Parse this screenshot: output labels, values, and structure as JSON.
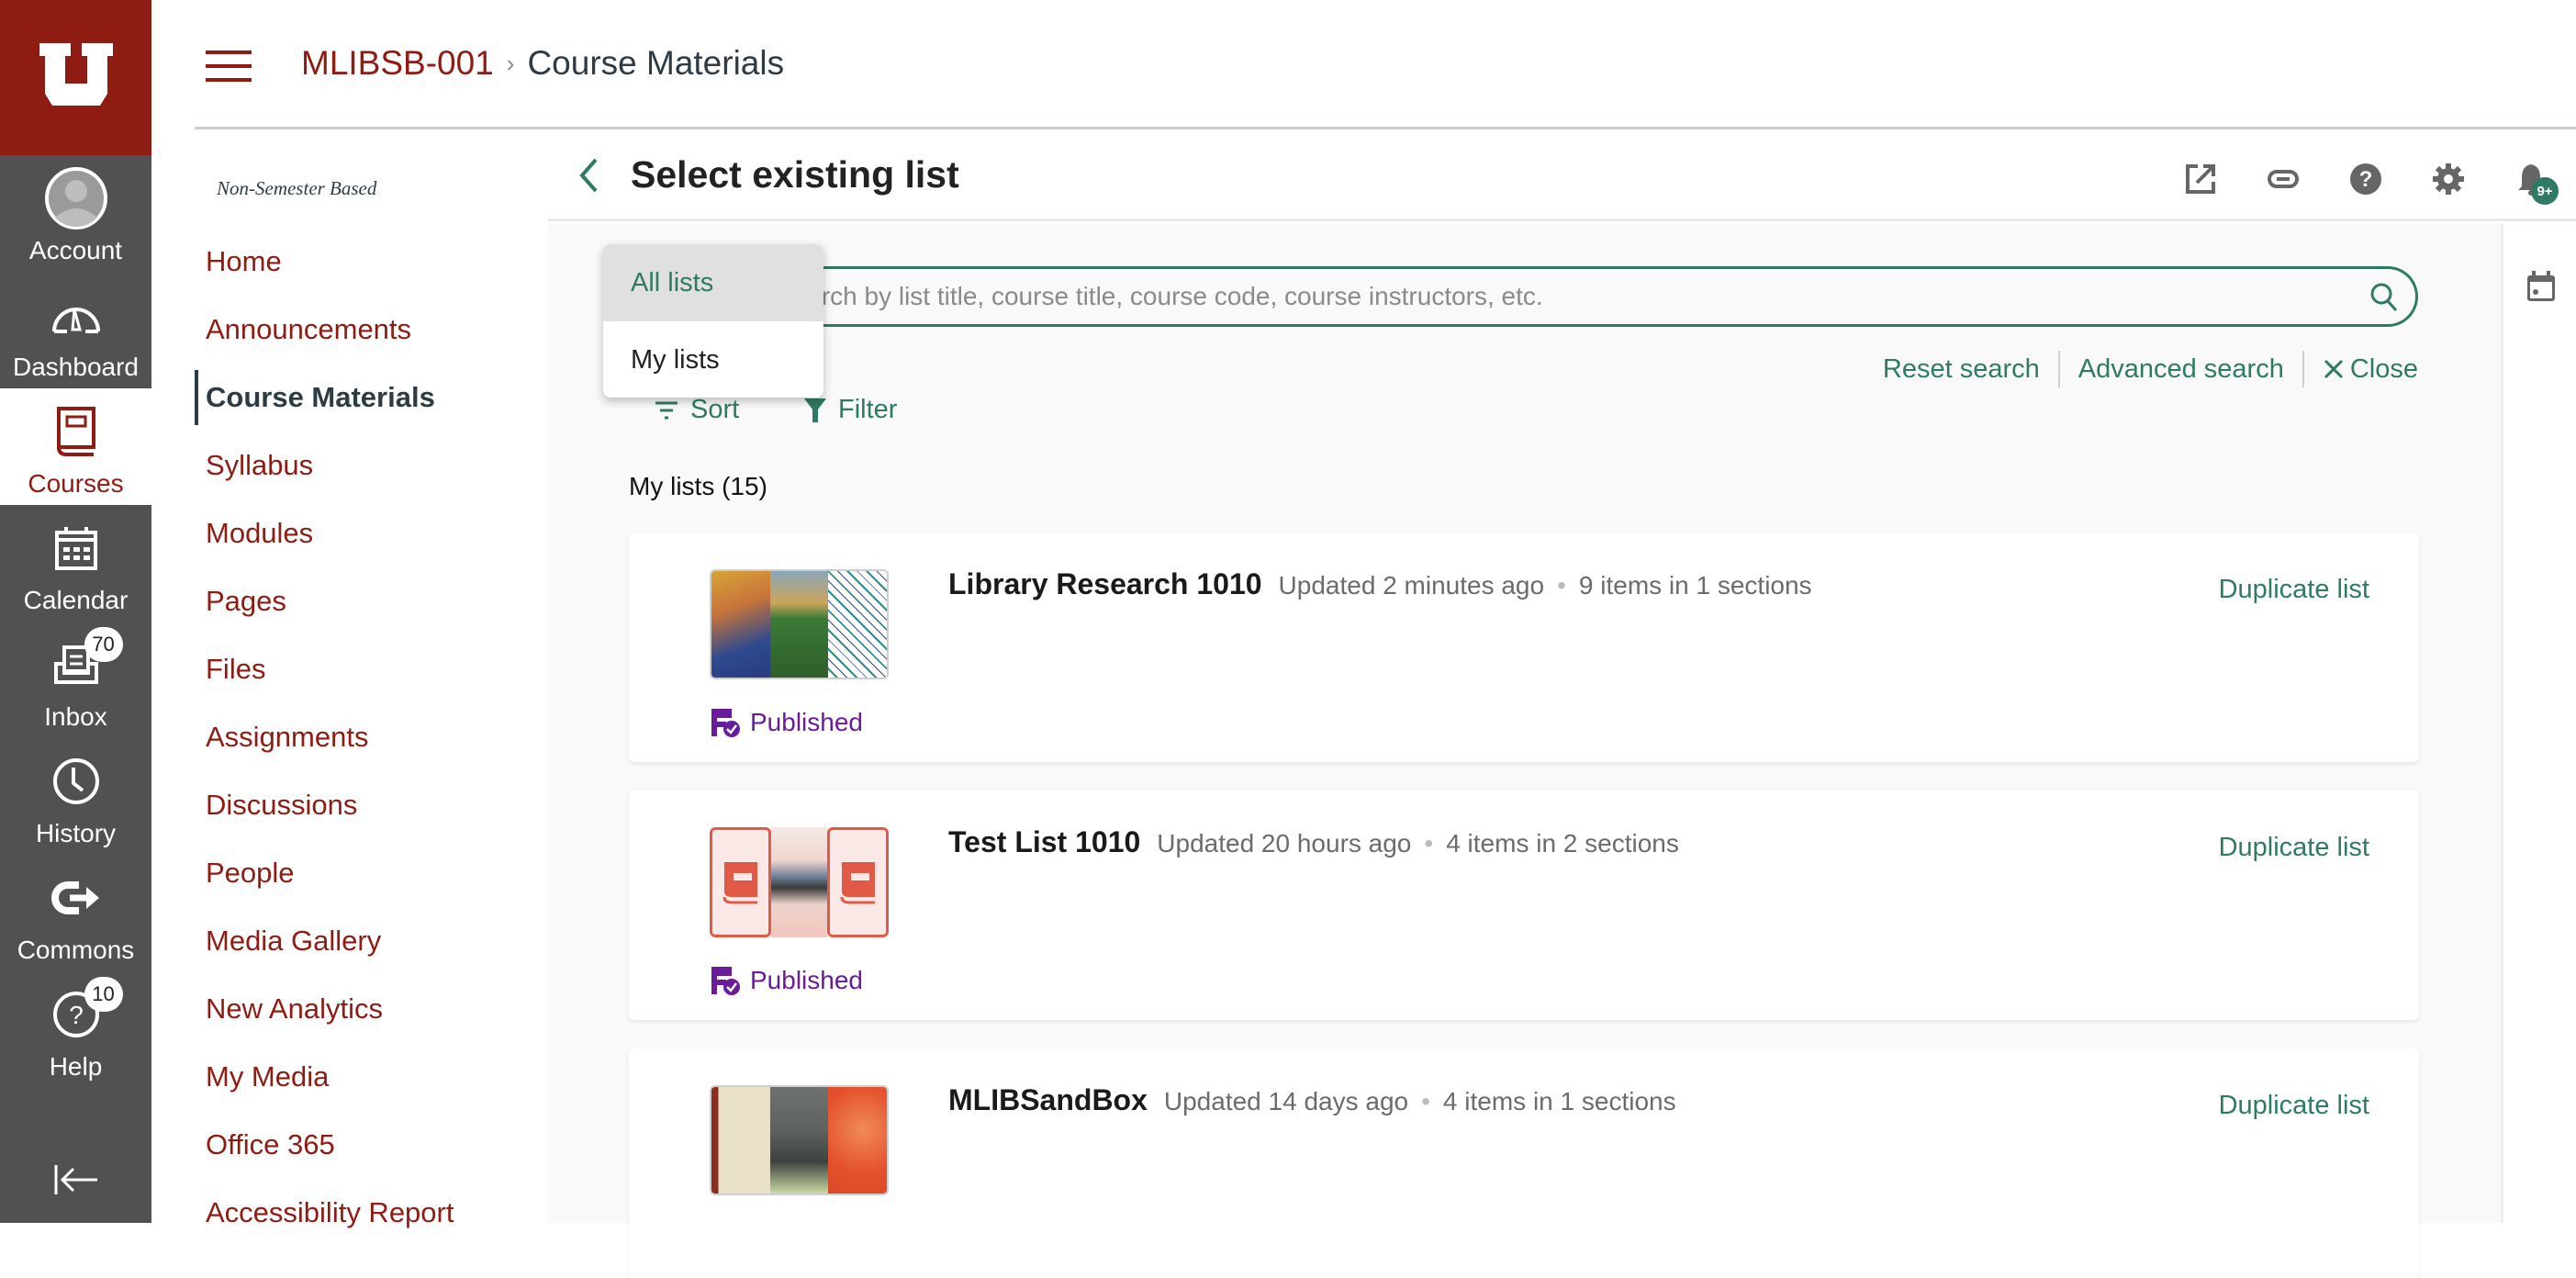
{
  "global_nav": {
    "items": [
      {
        "id": "account",
        "label": "Account",
        "icon": "avatar-icon"
      },
      {
        "id": "dashboard",
        "label": "Dashboard",
        "icon": "dashboard-icon"
      },
      {
        "id": "courses",
        "label": "Courses",
        "icon": "courses-icon",
        "active": true
      },
      {
        "id": "calendar",
        "label": "Calendar",
        "icon": "calendar-icon"
      },
      {
        "id": "inbox",
        "label": "Inbox",
        "icon": "inbox-icon",
        "badge": "70"
      },
      {
        "id": "history",
        "label": "History",
        "icon": "history-icon"
      },
      {
        "id": "commons",
        "label": "Commons",
        "icon": "commons-icon"
      },
      {
        "id": "help",
        "label": "Help",
        "icon": "help-icon",
        "badge": "10"
      }
    ]
  },
  "breadcrumb": {
    "course": "MLIBSB-001",
    "separator": "›",
    "current": "Course Materials"
  },
  "course_nav": {
    "subtitle": "Non-Semester Based",
    "items": [
      {
        "label": "Home"
      },
      {
        "label": "Announcements"
      },
      {
        "label": "Course Materials",
        "active": true
      },
      {
        "label": "Syllabus"
      },
      {
        "label": "Modules"
      },
      {
        "label": "Pages"
      },
      {
        "label": "Files"
      },
      {
        "label": "Assignments"
      },
      {
        "label": "Discussions"
      },
      {
        "label": "People"
      },
      {
        "label": "Media Gallery"
      },
      {
        "label": "New Analytics"
      },
      {
        "label": "My Media"
      },
      {
        "label": "Office 365"
      },
      {
        "label": "Accessibility Report"
      }
    ]
  },
  "tool": {
    "title": "Select existing list",
    "notification_badge": "9+",
    "search": {
      "placeholder": "Search by list title, course title, course code, course instructors, etc.",
      "value": ""
    },
    "scope_dropdown": {
      "options": [
        "All lists",
        "My lists"
      ],
      "selected": "All lists"
    },
    "links": {
      "reset": "Reset search",
      "advanced": "Advanced search",
      "close": "Close"
    },
    "sort_label": "Sort",
    "filter_label": "Filter",
    "section_heading": "My lists (15)",
    "lists": [
      {
        "title": "Library Research 1010",
        "updated": "Updated 2 minutes ago",
        "items": "9 items in 1 sections",
        "status": "Published",
        "action": "Duplicate list"
      },
      {
        "title": "Test List 1010",
        "updated": "Updated 20 hours ago",
        "items": "4 items in 2 sections",
        "status": "Published",
        "action": "Duplicate list"
      },
      {
        "title": "MLIBSandBox",
        "updated": "Updated 14 days ago",
        "items": "4 items in 1 sections",
        "status": "",
        "action": "Duplicate list"
      }
    ]
  },
  "colors": {
    "brand_red": "#8f1c13",
    "nav_gray": "#515151",
    "accent_green": "#2f7a64",
    "published_purple": "#6a1b9a"
  }
}
